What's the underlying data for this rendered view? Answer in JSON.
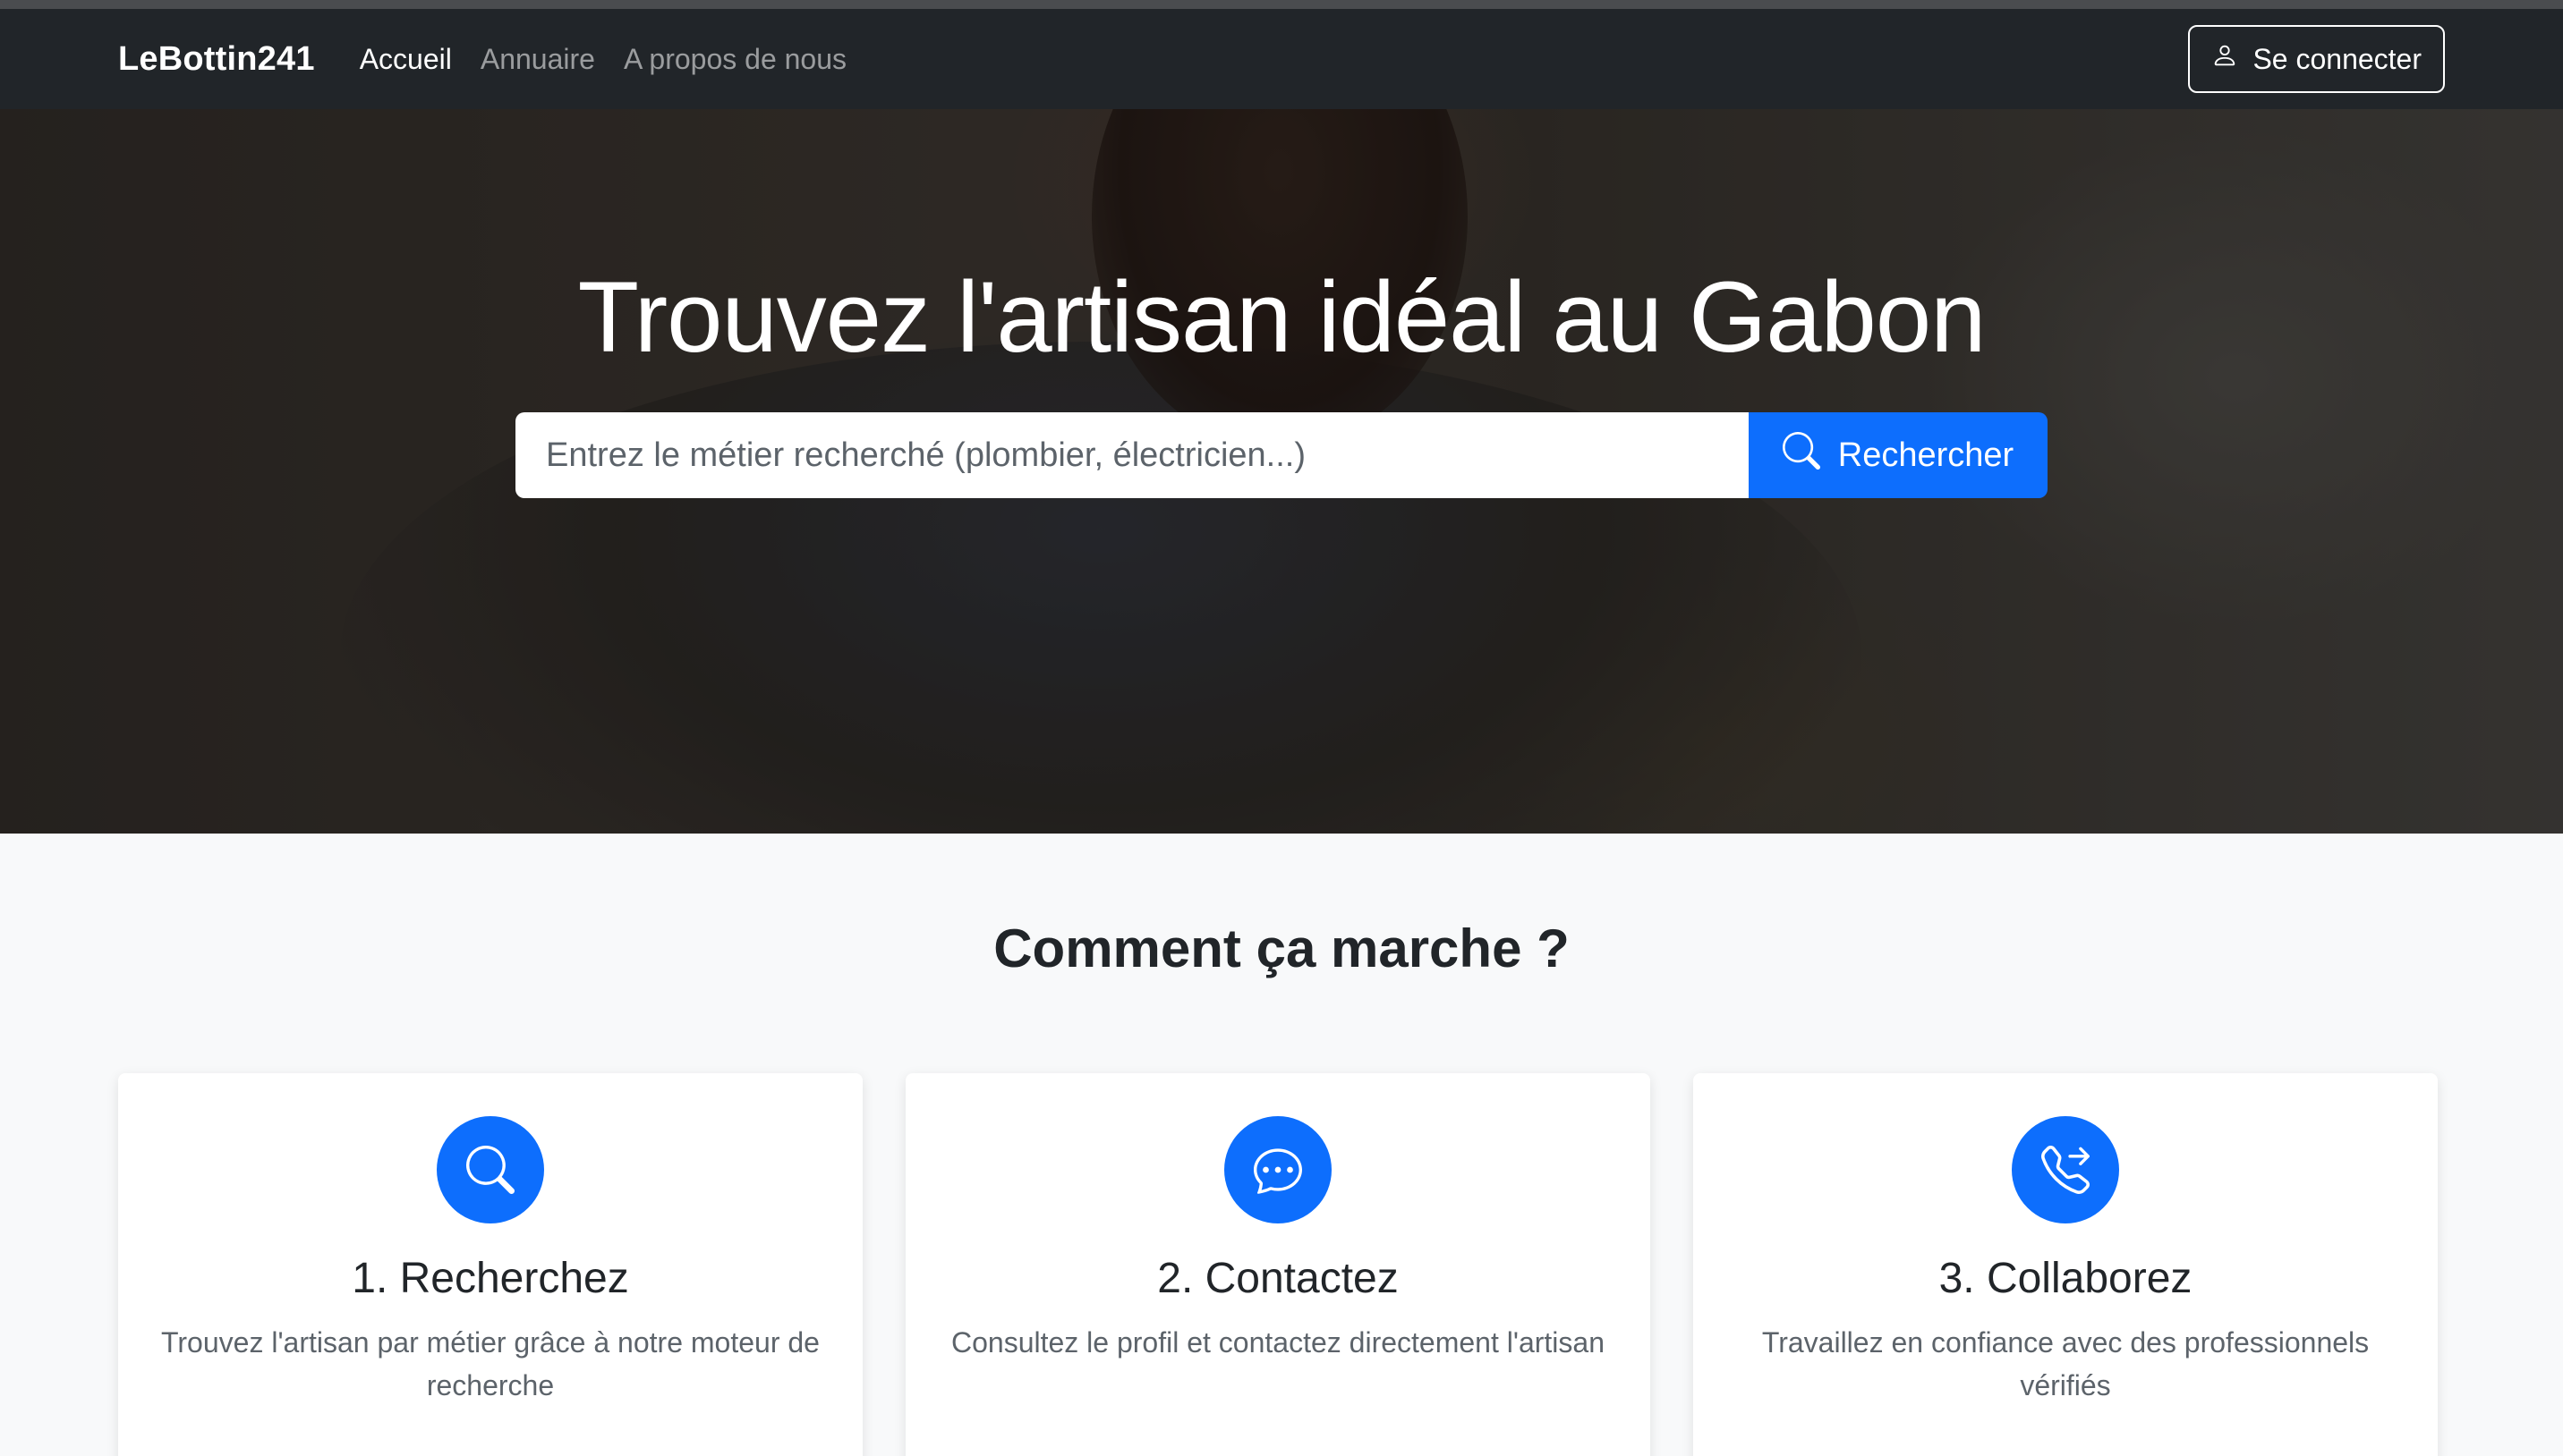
{
  "navbar": {
    "brand": "LeBottin241",
    "links": [
      {
        "label": "Accueil",
        "active": true
      },
      {
        "label": "Annuaire",
        "active": false
      },
      {
        "label": "A propos de nous",
        "active": false
      }
    ],
    "login_label": "Se connecter",
    "login_icon": "person-icon"
  },
  "hero": {
    "title": "Trouvez l'artisan idéal au Gabon",
    "search": {
      "value": "",
      "placeholder": "Entrez le métier recherché (plombier, électricien...)",
      "button_label": "Rechercher",
      "button_icon": "search-icon"
    }
  },
  "how_it_works": {
    "title": "Comment ça marche ?",
    "steps": [
      {
        "title": "1. Recherchez",
        "text": "Trouvez l'artisan par métier grâce à notre moteur de recherche",
        "icon": "search-icon"
      },
      {
        "title": "2. Contactez",
        "text": "Consultez le profil et contactez directement l'artisan",
        "icon": "chat-dots-icon"
      },
      {
        "title": "3. Collaborez",
        "text": "Travaillez en confiance avec des professionnels vérifiés",
        "icon": "phone-forward-icon"
      }
    ]
  },
  "colors": {
    "navbar_bg": "#212529",
    "primary": "#0d6efd",
    "page_bg": "#f8f9fa",
    "card_bg": "#ffffff",
    "muted_text": "#5c636a"
  }
}
